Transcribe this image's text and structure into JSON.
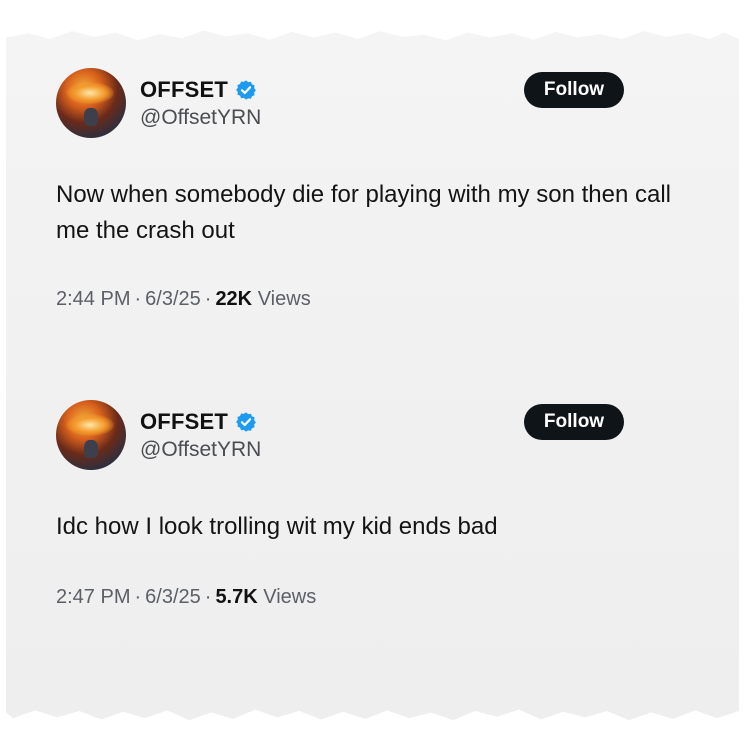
{
  "tweets": [
    {
      "display_name": "OFFSET",
      "handle": "@OffsetYRN",
      "follow_label": "Follow",
      "text": "Now when somebody die for playing with my son then call me the crash out",
      "time": "2:44 PM",
      "date": "6/3/25",
      "views_count": "22K",
      "views_label": "Views",
      "separator": "·"
    },
    {
      "display_name": "OFFSET",
      "handle": "@OffsetYRN",
      "follow_label": "Follow",
      "text": "Idc how I look trolling wit my kid ends bad",
      "time": "2:47 PM",
      "date": "6/3/25",
      "views_count": "5.7K",
      "views_label": "Views",
      "separator": "·"
    }
  ],
  "icons": {
    "verified": "verified-badge-icon"
  },
  "colors": {
    "verified_blue": "#1d9bf0",
    "follow_bg": "#0f1419",
    "paper": "#f1f1f1"
  }
}
